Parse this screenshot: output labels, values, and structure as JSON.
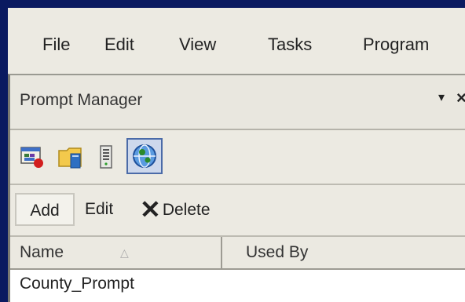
{
  "menu": {
    "items": [
      "File",
      "Edit",
      "View",
      "Tasks",
      "Program"
    ]
  },
  "panel": {
    "title": "Prompt Manager",
    "pin_glyph": "▾",
    "close_glyph": "×"
  },
  "icon_toolbar": {
    "icons": [
      "media-icon",
      "folder-icon",
      "server-icon",
      "globe-icon"
    ],
    "selected": "globe-icon"
  },
  "command_toolbar": {
    "add_label": "Add",
    "edit_label": "Edit",
    "delete_label": "Delete",
    "delete_glyph": "✕"
  },
  "list": {
    "columns": [
      "Name",
      "Used By"
    ],
    "sort_glyph": "△",
    "rows": [
      {
        "name": "County_Prompt",
        "used_by": ""
      }
    ]
  },
  "colors": {
    "window_frame": "#0a1a60",
    "selection_border": "#4b6ba8",
    "selection_fill": "#cdd8ec"
  }
}
